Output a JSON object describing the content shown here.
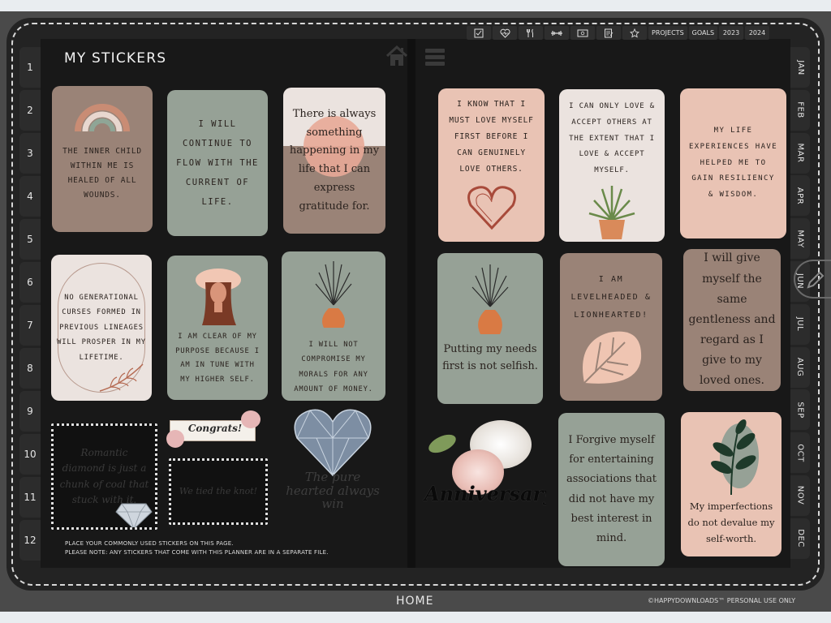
{
  "page": {
    "title": "MY STICKERS"
  },
  "number_tabs": [
    "1",
    "2",
    "3",
    "4",
    "5",
    "6",
    "7",
    "8",
    "9",
    "10",
    "11",
    "12"
  ],
  "month_tabs": [
    "JAN",
    "FEB",
    "MAR",
    "APR",
    "MAY",
    "JUN",
    "JUL",
    "AUG",
    "SEP",
    "OCT",
    "NOV",
    "DEC"
  ],
  "topbar": {
    "icons": [
      "checklist-icon",
      "heart-pulse-icon",
      "utensils-icon",
      "dumbbell-icon",
      "money-icon",
      "notes-icon",
      "star-icon"
    ],
    "labels": [
      "PROJECTS",
      "GOALS",
      "2023",
      "2024"
    ]
  },
  "stickers": {
    "s1": "THE INNER CHILD WITHIN ME IS HEALED OF ALL WOUNDS.",
    "s2": "I WILL CONTINUE TO FLOW WITH THE CURRENT OF LIFE.",
    "s3": "There is always something happening in my life that I can express gratitude for.",
    "s4": "NO GENERATIONAL CURSES FORMED IN PREVIOUS LINEAGES WILL PROSPER IN MY LIFETIME.",
    "s5": "I AM CLEAR OF MY PURPOSE BECAUSE I AM IN TUNE WITH MY HIGHER SELF.",
    "s6": "I WILL NOT COMPROMISE MY MORALS FOR ANY AMOUNT OF MONEY.",
    "s7": "Romantic diamond is just a chunk of coal that stuck with it.",
    "s8": "Congrats!",
    "s9": "We tied the knot!",
    "s10": "The pure hearted always win",
    "r1": "I KNOW THAT I MUST LOVE MYSELF FIRST BEFORE I CAN GENUINELY LOVE OTHERS.",
    "r2": "I CAN ONLY LOVE & ACCEPT OTHERS AT THE EXTENT THAT I LOVE & ACCEPT MYSELF.",
    "r3": "MY LIFE EXPERIENCES HAVE HELPED ME TO GAIN RESILIENCY & WISDOM.",
    "r4": "Putting my needs first is not selfish.",
    "r5": "I AM LEVELHEADED & LIONHEARTED!",
    "r6": "I will give myself the same gentleness and regard as I give to my loved ones.",
    "r7": "Anniversary",
    "r8": "I Forgive myself for entertaining associations that did not have my best interest in mind.",
    "r9": "My imperfections do not devalue my self-worth."
  },
  "note": {
    "line1": "PLACE YOUR COMMONLY USED STICKERS ON THIS PAGE.",
    "line2": "PLEASE NOTE: ANY STICKERS THAT COME WITH THIS PLANNER ARE IN A SEPARATE FILE."
  },
  "footer": {
    "home": "HOME",
    "copyright": "©HAPPYDOWNLOADS™ PERSONAL USE ONLY"
  },
  "colors": {
    "taupe": "#9a8377",
    "sage": "#96a196",
    "blush": "#e9c3b4",
    "cream": "#ebe3df",
    "terracotta": "#d97a44"
  }
}
